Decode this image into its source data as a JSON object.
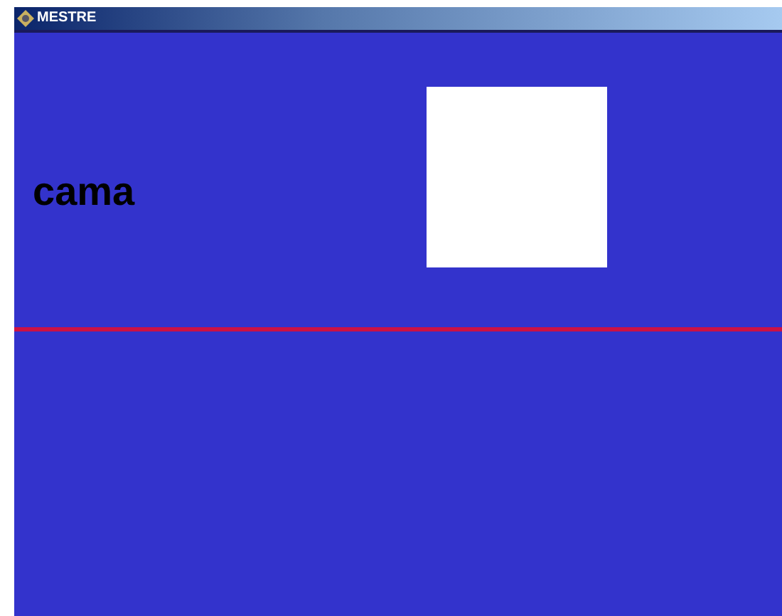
{
  "window": {
    "title": "MESTRE"
  },
  "content": {
    "word": "cama",
    "image_card": {
      "kind": "blank"
    }
  }
}
